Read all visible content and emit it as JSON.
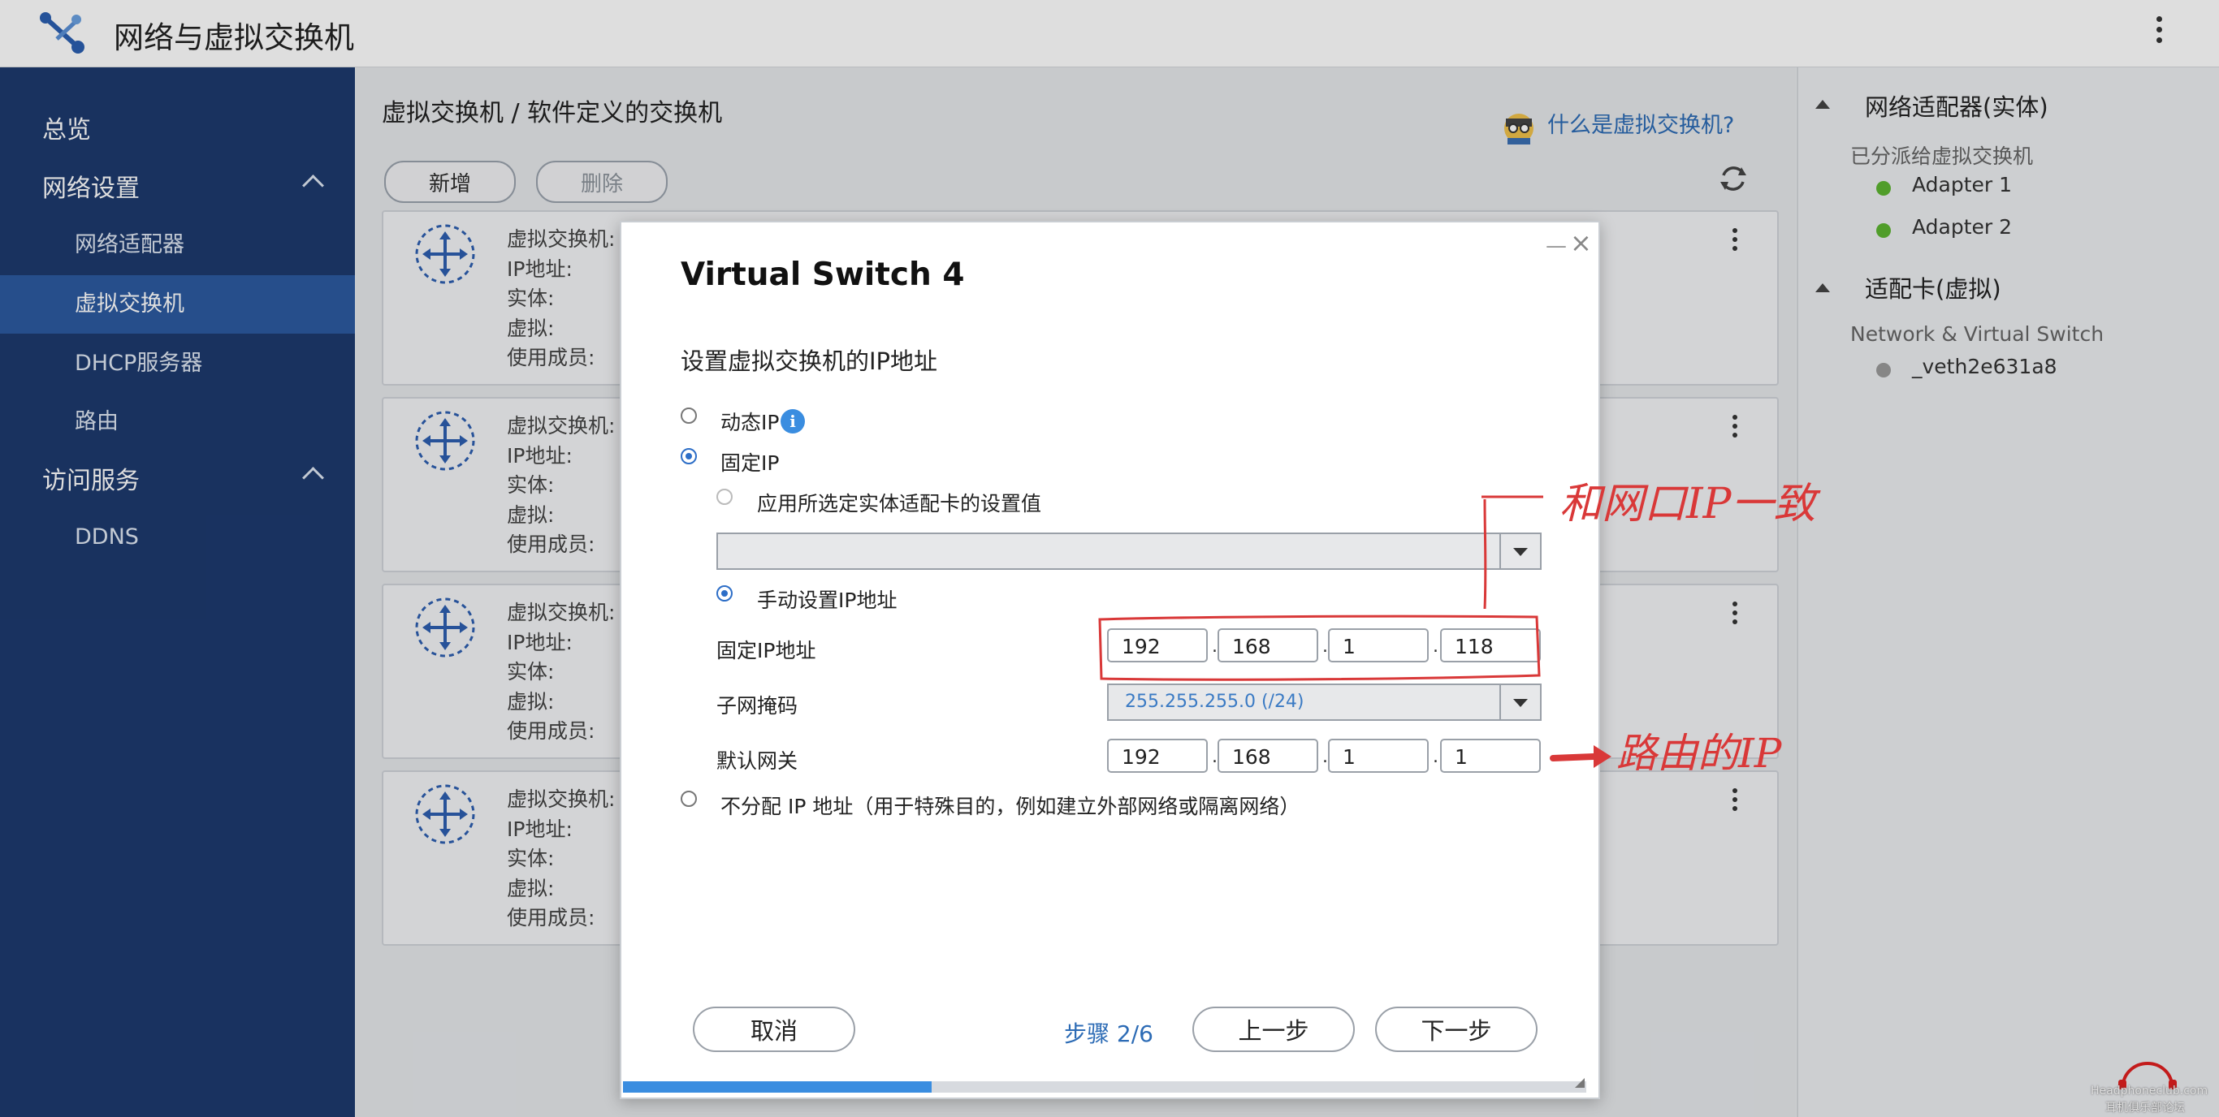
{
  "app": {
    "title": "网络与虚拟交换机"
  },
  "sidebar": {
    "items": [
      {
        "label": "总览"
      },
      {
        "label": "网络设置"
      },
      {
        "label": "网络适配器"
      },
      {
        "label": "虚拟交换机"
      },
      {
        "label": "DHCP服务器"
      },
      {
        "label": "路由"
      },
      {
        "label": "访问服务"
      },
      {
        "label": "DDNS"
      }
    ]
  },
  "main": {
    "breadcrumb": "虚拟交换机 / 软件定义的交换机",
    "help_link": "什么是虚拟交换机?",
    "add_label": "新增",
    "delete_label": "删除",
    "card_labels": [
      "虚拟交换机:",
      "IP地址:",
      "实体:",
      "虚拟:",
      "使用成员:"
    ]
  },
  "right_panel": {
    "physical_title": "网络适配器(实体)",
    "physical_subtitle": "已分派给虚拟交换机",
    "adapters": [
      "Adapter 1",
      "Adapter 2"
    ],
    "virtual_title": "适配卡(虚拟)",
    "virtual_subtitle": "Network & Virtual Switch",
    "virtual_adapters": [
      "_veth2e631a8"
    ],
    "colors": {
      "online": "#5cb531",
      "offline": "#9a9a9a"
    }
  },
  "dialog": {
    "title": "Virtual Switch 4",
    "section": "设置虚拟交换机的IP地址",
    "dynamic_ip": "动态IP",
    "static_ip": "固定IP",
    "apply_adapter": "应用所选定实体适配卡的设置值",
    "manual_ip": "手动设置IP地址",
    "fixed_ip_label": "固定IP地址",
    "fixed_ip": [
      "192",
      "168",
      "1",
      "118"
    ],
    "subnet_label": "子网掩码",
    "subnet_value": "255.255.255.0 (/24)",
    "gateway_label": "默认网关",
    "gateway": [
      "192",
      "168",
      "1",
      "1"
    ],
    "no_ip": "不分配 IP 地址（用于特殊目的，例如建立外部网络或隔离网络）",
    "cancel": "取消",
    "step": "步骤 2/6",
    "prev": "上一步",
    "next": "下一步",
    "progress": 0.32
  },
  "annotations": {
    "match_note": "和网口IP一致",
    "router_note": "路由的IP"
  },
  "watermark": {
    "line1": "Headphoneclub.com",
    "line2": "耳机俱乐部论坛"
  }
}
